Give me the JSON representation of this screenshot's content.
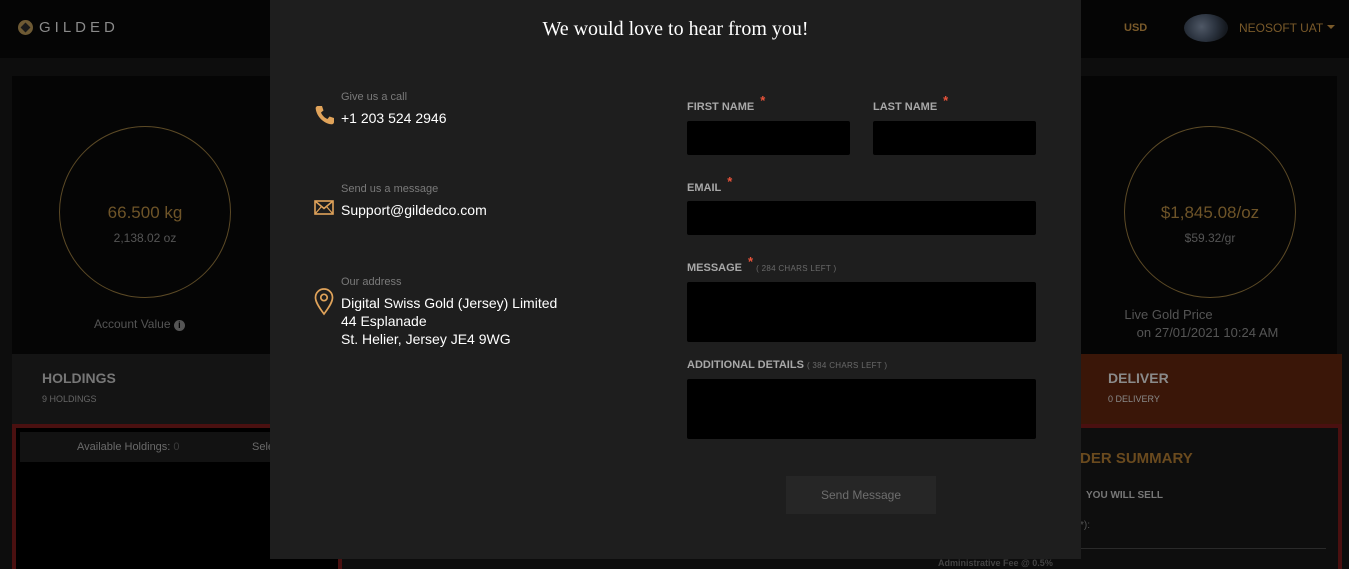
{
  "header": {
    "brand": "GILDED",
    "currency": "USD",
    "user_name": "NEOSOFT UAT"
  },
  "account": {
    "weight_kg": "66.500 kg",
    "weight_oz": "2,138.02 oz",
    "label": "Account Value"
  },
  "gold_price": {
    "per_oz": "$1,845.08/oz",
    "per_gr": "$59.32/gr",
    "label": "Live Gold Price",
    "timestamp": "on 27/01/2021 10:24 AM"
  },
  "tabs": {
    "holdings_title": "HOLDINGS",
    "holdings_sub": "9 HOLDINGS",
    "deliver_title": "DELIVER",
    "deliver_sub": "0 DELIVERY"
  },
  "holdings_panel": {
    "available_label": "Available Holdings:",
    "available_count": "0",
    "select_partial": "Sele"
  },
  "order_summary": {
    "title_partial": "DER SUMMARY",
    "you_will_sell": "YOU WILL SELL",
    "colon_partial": "*):",
    "admin_fee": "Administrative Fee @ 0.5%"
  },
  "modal": {
    "title": "We would love to hear from you!",
    "contact": {
      "call_label": "Give us a call",
      "call_value": "+1 203 524 2946",
      "message_label": "Send us a message",
      "message_value": "Support@gildedco.com",
      "address_label": "Our address",
      "address_line1": "Digital Swiss Gold (Jersey) Limited",
      "address_line2": "44 Esplanade",
      "address_line3": "St. Helier, Jersey JE4 9WG"
    },
    "form": {
      "first_name_label": "FIRST NAME",
      "last_name_label": "LAST NAME",
      "email_label": "EMAIL",
      "message_label": "MESSAGE",
      "message_chars": "( 284 CHARS LEFT )",
      "additional_label": "ADDITIONAL DETAILS",
      "additional_chars": "( 384 CHARS LEFT )",
      "required_mark": "*",
      "first_name_value": "",
      "last_name_value": "",
      "email_value": "",
      "message_value": "",
      "additional_value": "",
      "send_label": "Send Message"
    }
  },
  "colors": {
    "accent_gold": "#e0a35a",
    "required_red": "#e8533a",
    "deliver_tab": "#3a1608"
  }
}
